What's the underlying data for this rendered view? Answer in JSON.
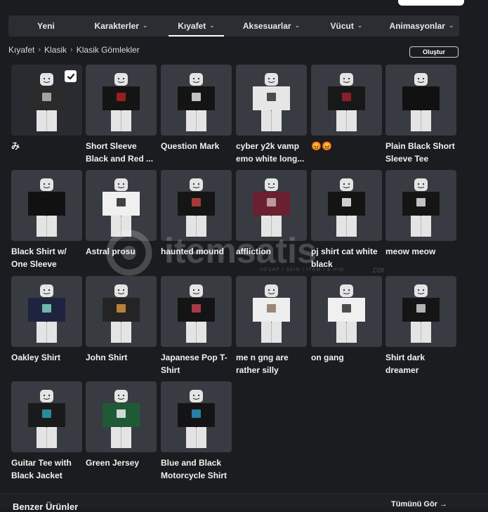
{
  "nav": {
    "tabs": [
      {
        "label": "Yeni",
        "has_dropdown": false,
        "active": false
      },
      {
        "label": "Karakterler",
        "has_dropdown": true,
        "active": false
      },
      {
        "label": "Kıyafet",
        "has_dropdown": true,
        "active": true
      },
      {
        "label": "Aksesuarlar",
        "has_dropdown": true,
        "active": false
      },
      {
        "label": "Vücut",
        "has_dropdown": true,
        "active": false
      },
      {
        "label": "Animasyonlar",
        "has_dropdown": true,
        "active": false
      }
    ]
  },
  "breadcrumb": [
    "Kıyafet",
    "Klasik",
    "Klasik Gömlekler"
  ],
  "create_button": "Oluştur",
  "items": [
    {
      "name": "み",
      "shirt": "#2a2a2a",
      "accent": "#b8b8b8",
      "selected": true
    },
    {
      "name": "Short Sleeve Black and Red ...",
      "shirt": "#141414",
      "accent": "#b02020",
      "selected": false
    },
    {
      "name": "Question Mark",
      "shirt": "#141414",
      "accent": "#e0e0e0",
      "selected": false
    },
    {
      "name": "cyber y2k vamp emo white long...",
      "shirt": "#e6e6e6",
      "accent": "#303030",
      "selected": false
    },
    {
      "name": "😡😡",
      "shirt": "#181818",
      "accent": "#a02030",
      "selected": false
    },
    {
      "name": "Plain Black Short Sleeve Tee",
      "shirt": "#111111",
      "accent": "#111111",
      "selected": false
    },
    {
      "name": "Black Shirt w/ One Sleeve",
      "shirt": "#111111",
      "accent": "#111111",
      "selected": false
    },
    {
      "name": "Astral prosu",
      "shirt": "#f0f0f0",
      "accent": "#222222",
      "selected": false
    },
    {
      "name": "haunted mound",
      "shirt": "#151515",
      "accent": "#c04040",
      "selected": false
    },
    {
      "name": "affliction",
      "shirt": "#6a2030",
      "accent": "#c8b0b0",
      "selected": false
    },
    {
      "name": "pj shirt cat white black",
      "shirt": "#141414",
      "accent": "#f0f0f0",
      "selected": false
    },
    {
      "name": "meow meow",
      "shirt": "#151515",
      "accent": "#e0e0e0",
      "selected": false
    },
    {
      "name": "Oakley Shirt",
      "shirt": "#1e2440",
      "accent": "#7fd0c0",
      "selected": false
    },
    {
      "name": "John Shirt",
      "shirt": "#242424",
      "accent": "#d09040",
      "selected": false
    },
    {
      "name": "Japanese Pop T-Shirt",
      "shirt": "#141414",
      "accent": "#c04050",
      "selected": false
    },
    {
      "name": "me n gng are rather silly",
      "shirt": "#eeeeee",
      "accent": "#8a7560",
      "selected": false
    },
    {
      "name": "on gang",
      "shirt": "#f0f0f0",
      "accent": "#303030",
      "selected": false
    },
    {
      "name": "Shirt dark dreamer",
      "shirt": "#151515",
      "accent": "#d0d0d0",
      "selected": false
    },
    {
      "name": "Guitar Tee with Black Jacket",
      "shirt": "#1a1a1a",
      "accent": "#2aa0b0",
      "selected": false
    },
    {
      "name": "Green Jersey",
      "shirt": "#1e5a35",
      "accent": "#f0f0f0",
      "selected": false
    },
    {
      "name": "Blue and Black Motorcycle Shirt",
      "shirt": "#141414",
      "accent": "#2a90c0",
      "selected": false
    }
  ],
  "watermark": {
    "brand": "itemsatis",
    "tagline": "HESAP / SKIN / ITEM / E-PIN",
    "domain": ".com"
  },
  "section": {
    "title": "Benzer Ürünler",
    "see_all": "Tümünü Gör"
  },
  "colors": {
    "background": "#1b1c1f",
    "nav": "#2b2d33",
    "thumb": "#393b42"
  }
}
